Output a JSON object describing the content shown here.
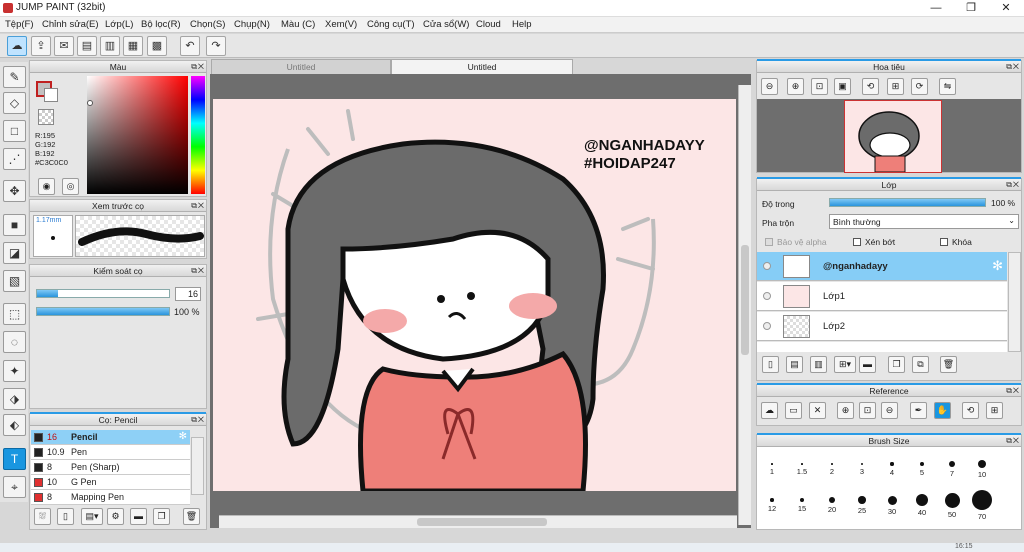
{
  "window": {
    "title": "JUMP PAINT (32bit)",
    "min": "—",
    "max": "❐",
    "close": "✕"
  },
  "menu": [
    "Tệp(F)",
    "Chỉnh sửa(E)",
    "Lớp(L)",
    "Bộ lọc(R)",
    "Chọn(S)",
    "Chụp(N)",
    "Màu (C)",
    "Xem(V)",
    "Công cụ(T)",
    "Cửa sổ(W)",
    "Cloud",
    "Help"
  ],
  "tabs": [
    "Untitled",
    "Untitled"
  ],
  "color_panel": {
    "title": "Màu",
    "r": "R:195",
    "g": "G:192",
    "b": "B:192",
    "hex": "#C3C0C0",
    "color": "#C3C0C0"
  },
  "preview_panel": {
    "title": "Xem trước cọ",
    "size": "1.17mm"
  },
  "brush_control": {
    "title": "Kiểm soát cọ",
    "size_value": "16",
    "opacity_value": "100 %",
    "size_fraction": 0.16,
    "opacity_fraction": 1.0
  },
  "brush_list": {
    "title": "Cọ: Pencil",
    "items": [
      {
        "size": "16",
        "name": "Pencil",
        "color": "#222222"
      },
      {
        "size": "10.9",
        "name": "Pen",
        "color": "#222222"
      },
      {
        "size": "8",
        "name": "Pen (Sharp)",
        "color": "#222222"
      },
      {
        "size": "10",
        "name": "G Pen",
        "color": "#e03030"
      },
      {
        "size": "8",
        "name": "Mapping Pen",
        "color": "#e03030"
      }
    ]
  },
  "navigator": {
    "title": "Hoa tiêu"
  },
  "layers": {
    "title": "Lớp",
    "opacity_label": "Độ trong",
    "opacity_value": "100 %",
    "opacity_fraction": 1.0,
    "blend_label": "Pha trộn",
    "blend_value": "Bình thường",
    "protect_alpha": "Bảo vệ alpha",
    "clipping": "Xén bớt",
    "lock": "Khóa",
    "items": [
      {
        "name": "@nganhadayy"
      },
      {
        "name": "Lớp1"
      },
      {
        "name": "Lớp2"
      }
    ]
  },
  "reference": {
    "title": "Reference"
  },
  "brush_size": {
    "title": "Brush Size",
    "row1": [
      "1",
      "1.5",
      "2",
      "3",
      "4",
      "5",
      "7",
      "10"
    ],
    "row2": [
      "12",
      "15",
      "20",
      "25",
      "30",
      "40",
      "50",
      "70"
    ]
  },
  "artwork": {
    "line1": "@NGANHADAYY",
    "line2": "#HOIDAP247"
  },
  "taskbar": {
    "time": "16:15"
  }
}
